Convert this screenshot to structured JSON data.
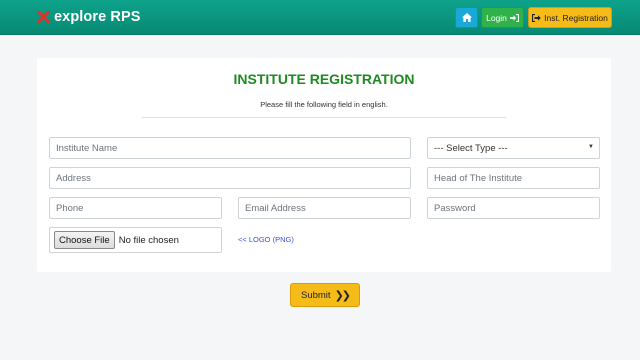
{
  "brand": {
    "name": "explore RPS",
    "icon": "cross-icon",
    "icon_color": "#e0312a"
  },
  "nav": {
    "home_icon": "home-icon",
    "login_label": "Login",
    "login_icon": "sign-in-icon",
    "register_label": "Inst. Registration",
    "register_icon": "sign-out-icon"
  },
  "form": {
    "title": "INSTITUTE REGISTRATION",
    "subtitle": "Please fill the following field in english.",
    "fields": {
      "institute_name": {
        "placeholder": "Institute Name",
        "value": ""
      },
      "type": {
        "selected": "--- Select Type ---"
      },
      "address": {
        "placeholder": "Address",
        "value": ""
      },
      "head": {
        "placeholder": "Head of The Institute",
        "value": ""
      },
      "phone": {
        "placeholder": "Phone",
        "value": ""
      },
      "email": {
        "placeholder": "Email Address",
        "value": ""
      },
      "password": {
        "placeholder": "Password",
        "value": ""
      }
    },
    "file": {
      "button_label": "Choose File",
      "status": "No file chosen",
      "hint": "<< LOGO (PNG)"
    },
    "submit_label": "Submit"
  },
  "colors": {
    "navbar": "#0ea28a",
    "title": "#1f8a22",
    "home_button": "#1aa9d6",
    "login_button": "#2fb24a",
    "register_button": "#f5bb18",
    "submit_button": "#f5bb18",
    "hint_link": "#3a4fd6"
  }
}
